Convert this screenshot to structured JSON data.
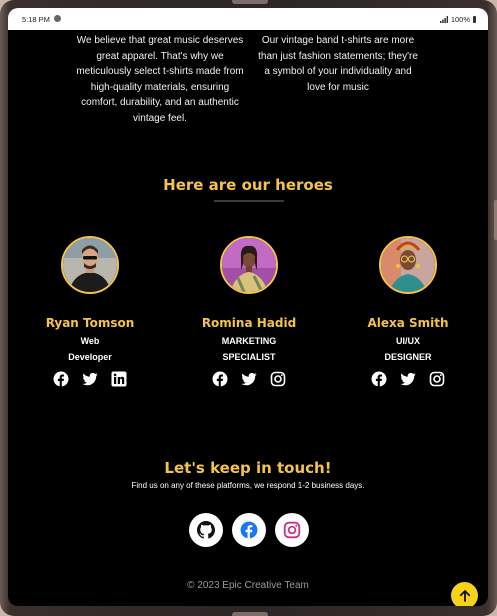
{
  "status_bar": {
    "time": "5:18 PM",
    "battery": "100%"
  },
  "about": {
    "left_text": "We believe that great music deserves great apparel. That's why we meticulously select t-shirts made from high-quality materials, ensuring comfort, durability, and an authentic vintage feel.",
    "right_text": "Our vintage band t-shirts are more than just fashion statements; they're a symbol of your individuality and love for music"
  },
  "heroes": {
    "title": "Here are our heroes",
    "members": [
      {
        "name": "Ryan Tomson",
        "role_line1": "Web",
        "role_line2": "Developer",
        "social": [
          "facebook-icon",
          "twitter-icon",
          "linkedin-icon"
        ]
      },
      {
        "name": "Romina Hadid",
        "role_line1": "MARKETING",
        "role_line2": "SPECIALIST",
        "social": [
          "facebook-icon",
          "twitter-icon",
          "instagram-icon"
        ]
      },
      {
        "name": "Alexa Smith",
        "role_line1": "UI/UX",
        "role_line2": "DESIGNER",
        "social": [
          "facebook-icon",
          "twitter-icon",
          "instagram-icon"
        ]
      }
    ]
  },
  "contact": {
    "title": "Let's keep in touch!",
    "subtitle": "Find us on any of these platforms, we respond 1-2 business days.",
    "platforms": [
      "github-icon",
      "facebook-icon",
      "instagram-icon"
    ]
  },
  "footer": {
    "copyright": "© 2023 Epic Creative Team"
  },
  "colors": {
    "accent": "#f3c34a",
    "background": "#000000",
    "back_to_top": "#f7d21b",
    "facebook": "#1877f2",
    "instagram": "#c13584"
  }
}
